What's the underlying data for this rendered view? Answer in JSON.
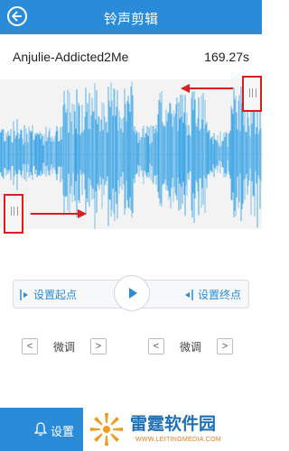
{
  "header": {
    "title": "铃声剪辑",
    "back_icon": "back-arrow-icon"
  },
  "track": {
    "name": "Anjulie-Addicted2Me",
    "duration": "169.27s"
  },
  "colors": {
    "primary": "#2a8bd9",
    "wave": "#3aa4e6",
    "annotation": "#d81e1e"
  },
  "controls": {
    "set_start_label": "设置起点",
    "set_end_label": "设置终点",
    "play_icon": "play-icon"
  },
  "fine_tune": {
    "left": {
      "prev": "<",
      "label": "微调",
      "next": ">"
    },
    "right": {
      "prev": "<",
      "label": "微调",
      "next": ">"
    }
  },
  "footer": {
    "settings_label": "设置",
    "brand_name": "雷霆软件园",
    "brand_url": "WWW.LEITINGMEDIA.COM"
  }
}
